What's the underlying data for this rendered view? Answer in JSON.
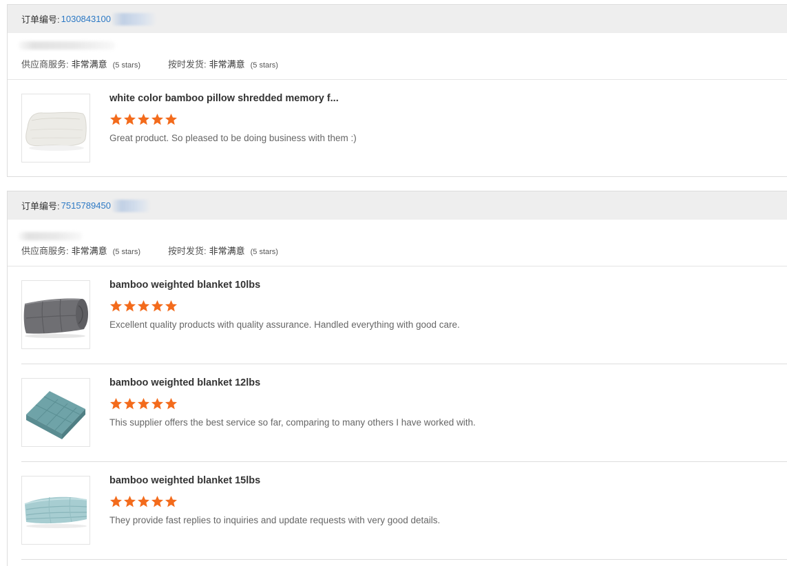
{
  "labels": {
    "order_no": "订单编号:",
    "supplier_service": "供应商服务:",
    "on_time_delivery": "按时发货:"
  },
  "colors": {
    "link": "#2b78c4",
    "star": "#f36b1c",
    "header_bg": "#eeeeee"
  },
  "orders": [
    {
      "order_number": "1030843100",
      "supplier_service_value": "非常满意",
      "supplier_service_note": "(5 stars)",
      "on_time_delivery_value": "非常满意",
      "on_time_delivery_note": "(5 stars)",
      "products": [
        {
          "title": "white color bamboo pillow shredded memory f...",
          "stars": 5,
          "review": "Great product. So pleased to be doing business with them :)",
          "image_icon": "pillow-image"
        }
      ]
    },
    {
      "order_number": "7515789450",
      "supplier_service_value": "非常满意",
      "supplier_service_note": "(5 stars)",
      "on_time_delivery_value": "非常满意",
      "on_time_delivery_note": "(5 stars)",
      "products": [
        {
          "title": "bamboo weighted blanket 10lbs",
          "stars": 5,
          "review": "Excellent quality products with quality assurance. Handled everything with good care.",
          "image_icon": "grey-rolled-blanket-image"
        },
        {
          "title": "bamboo weighted blanket 12lbs",
          "stars": 5,
          "review": "This supplier offers the best service so far, comparing to many others I have worked with.",
          "image_icon": "teal-folded-blanket-image"
        },
        {
          "title": "bamboo weighted blanket 15lbs",
          "stars": 5,
          "review": "They provide fast replies to inquiries and update requests with very good details.",
          "image_icon": "aqua-folded-blanket-image"
        }
      ]
    }
  ]
}
